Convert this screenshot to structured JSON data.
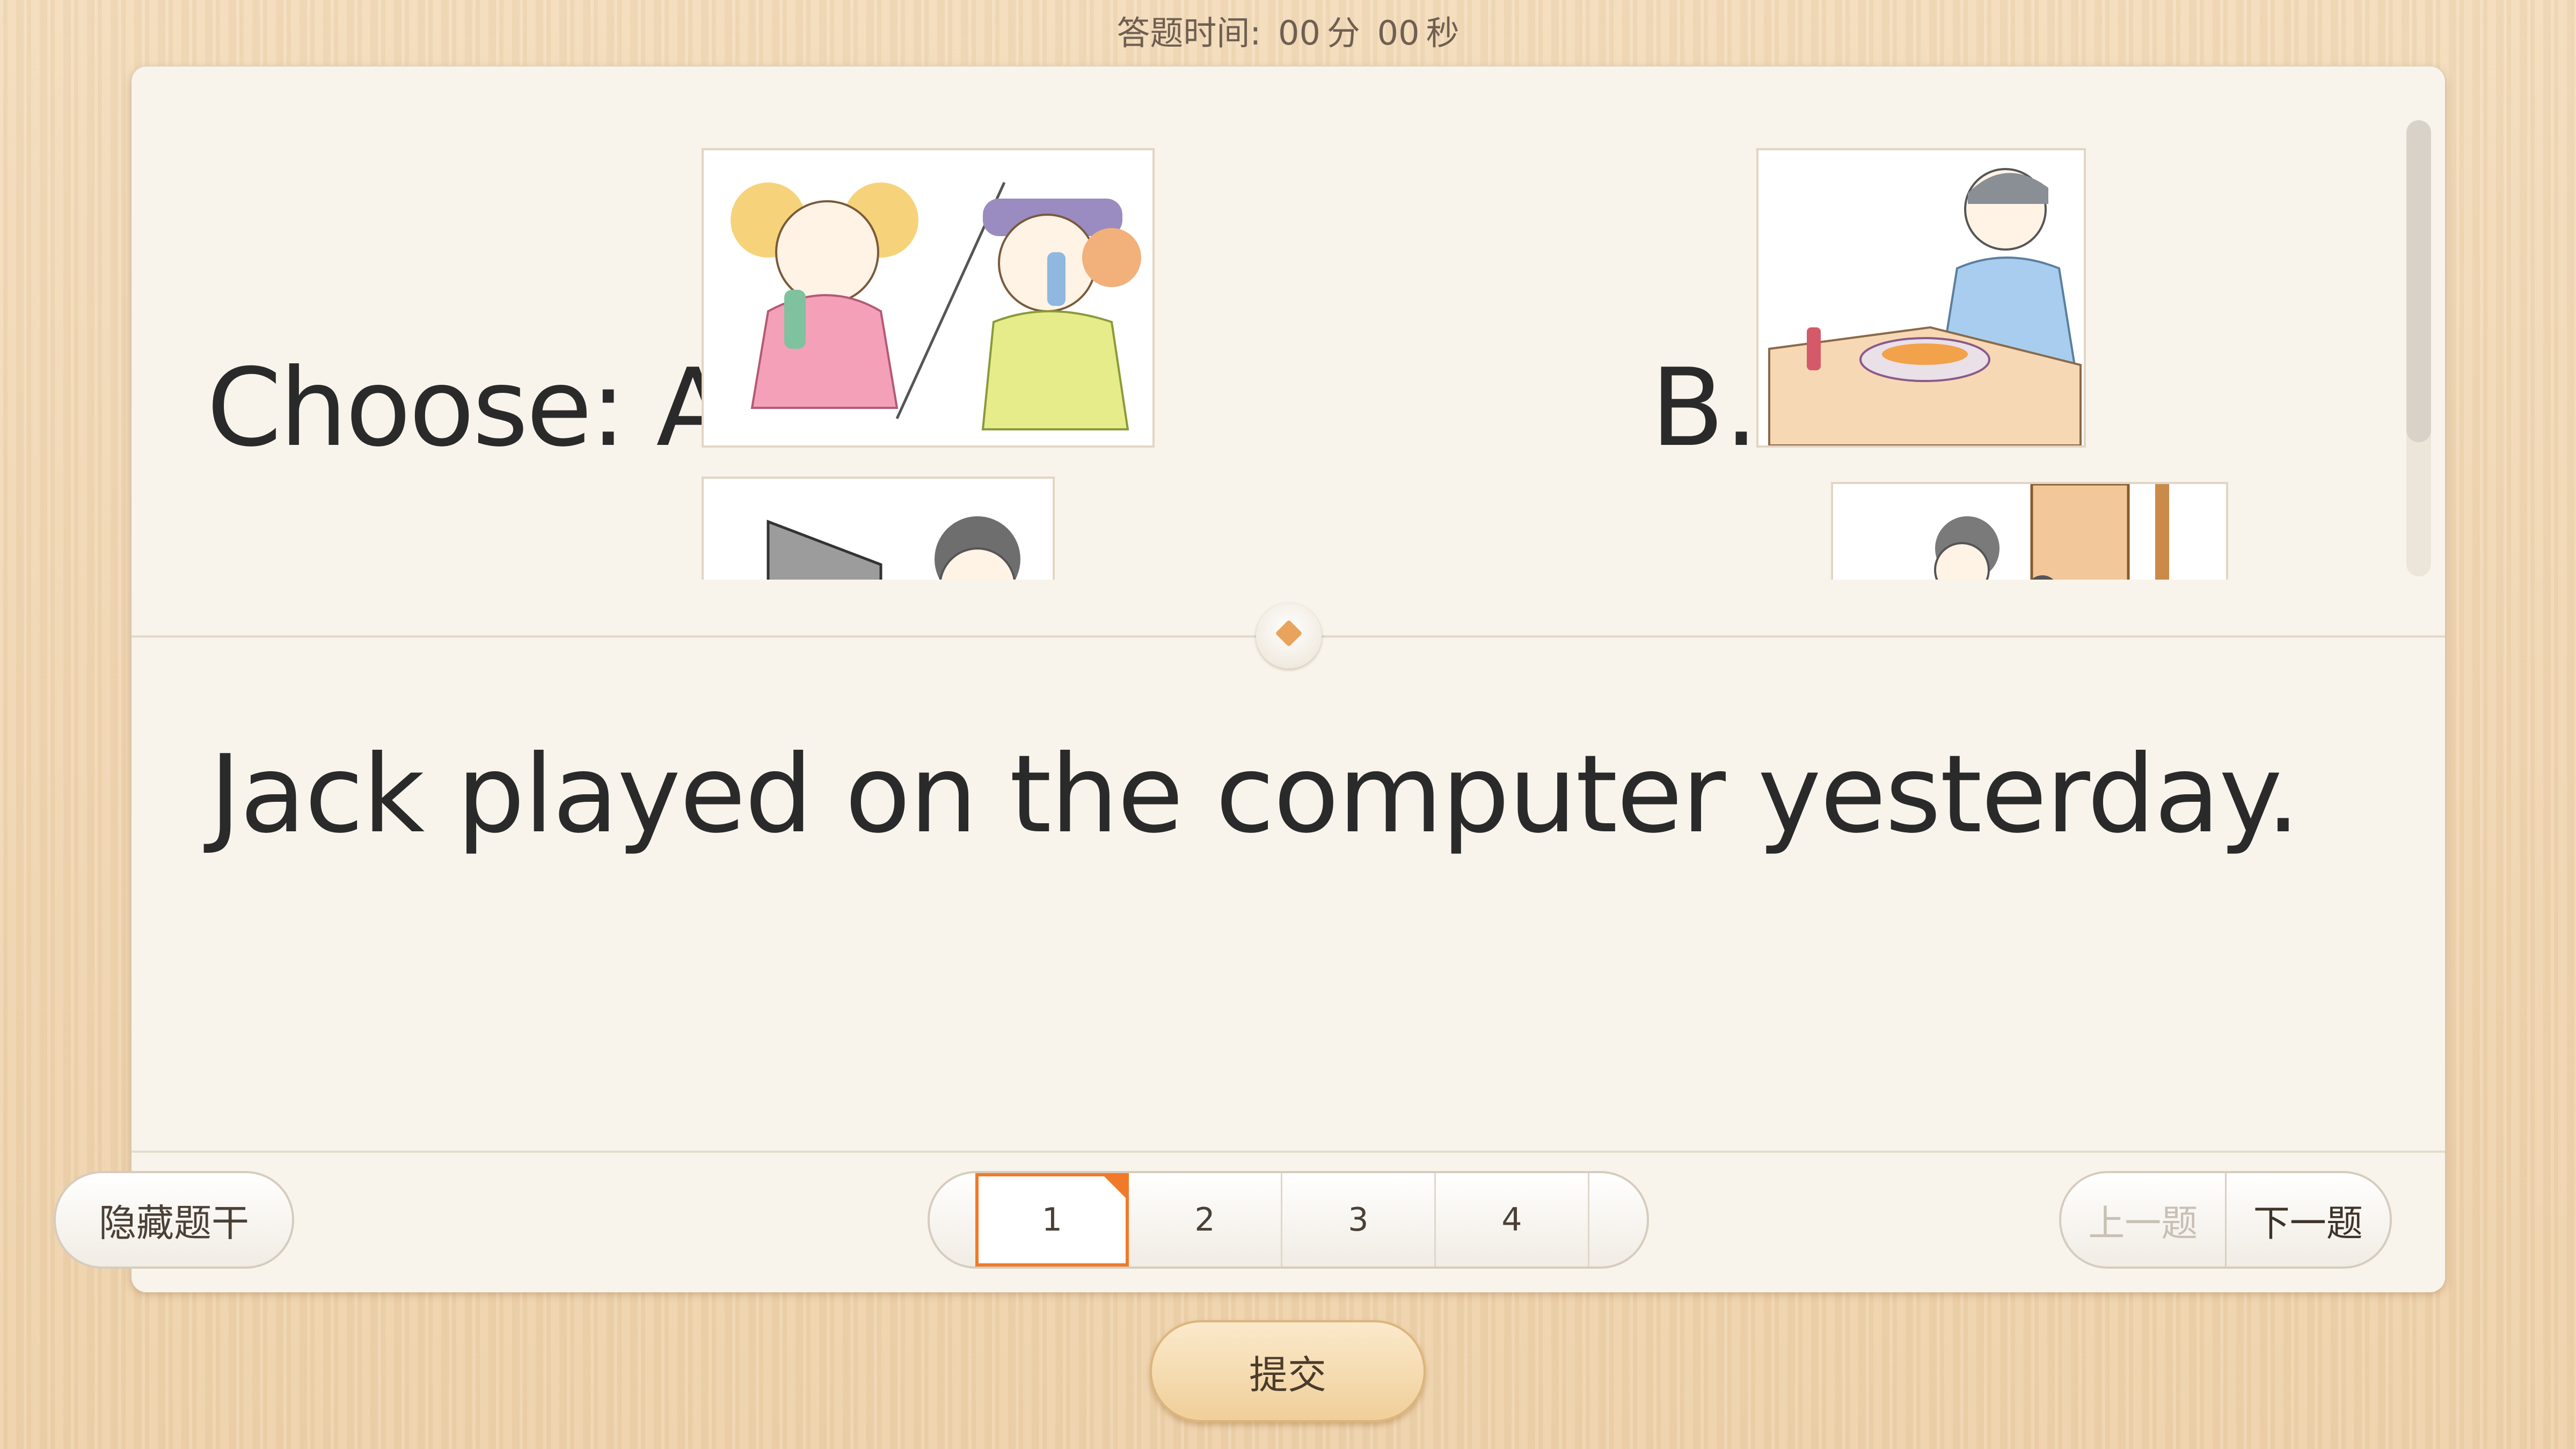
{
  "timer": {
    "label": "答题时间:",
    "minutes": "00",
    "min_unit": "分",
    "seconds": "00",
    "sec_unit": "秒"
  },
  "question": {
    "choose_label": "Choose: A.",
    "option_b_label": "B.",
    "sentence": "Jack played on the computer yesterday."
  },
  "toolbar": {
    "hide_stem": "隐藏题干",
    "pages": [
      "1",
      "2",
      "3",
      "4"
    ],
    "active_page": 1,
    "prev": "上一题",
    "next": "下一题"
  },
  "submit": {
    "label": "提交"
  },
  "colors": {
    "accent": "#f07a2a",
    "background": "#f0d6b2",
    "card": "#f8f4ec"
  }
}
